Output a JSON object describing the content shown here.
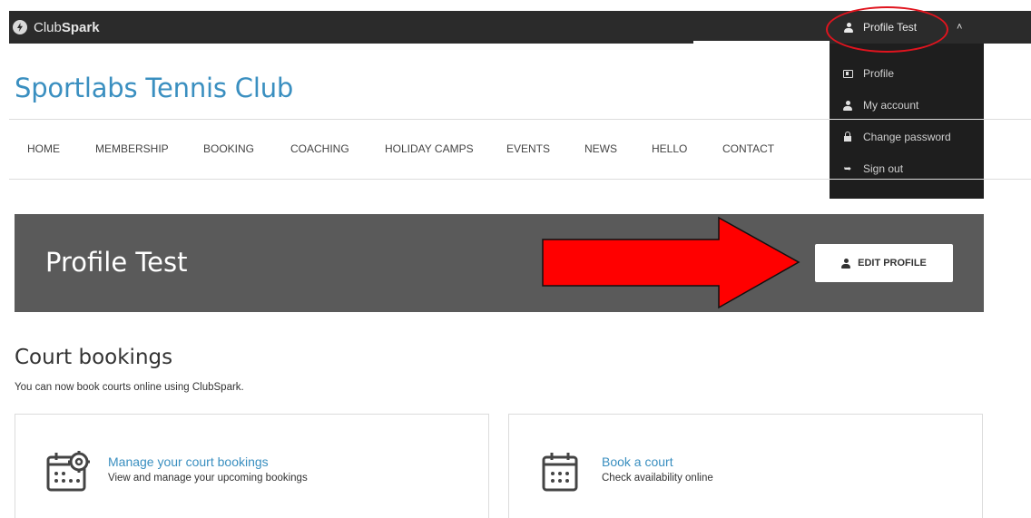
{
  "topbar": {
    "brand_light": "Club",
    "brand_bold": "Spark",
    "user_name": "Profile Test",
    "chevron": "^"
  },
  "dropdown": {
    "items": [
      {
        "label": "Profile",
        "icon": "id-card-icon"
      },
      {
        "label": "My account",
        "icon": "user-icon"
      },
      {
        "label": "Change password",
        "icon": "lock-icon"
      },
      {
        "label": "Sign out",
        "icon": "sign-out-icon"
      }
    ]
  },
  "header": {
    "club_name": "Sportlabs Tennis Club"
  },
  "nav": {
    "items": [
      "HOME",
      "MEMBERSHIP",
      "BOOKING",
      "COACHING",
      "HOLIDAY CAMPS",
      "EVENTS",
      "NEWS",
      "HELLO",
      "CONTACT"
    ]
  },
  "banner": {
    "title": "Profile Test",
    "edit_button": "EDIT PROFILE"
  },
  "court_bookings": {
    "title": "Court bookings",
    "subtitle": "You can now book courts online using ClubSpark.",
    "cards": [
      {
        "title": "Manage your court bookings",
        "description": "View and manage your upcoming bookings",
        "icon": "calendar-gear-icon"
      },
      {
        "title": "Book a court",
        "description": "Check availability online",
        "icon": "calendar-icon"
      }
    ]
  },
  "colors": {
    "accent": "#3a8fc0",
    "topbar": "#2b2b2b",
    "dropdown": "#1e1e1e",
    "banner": "#5a5a5a",
    "annotation_red": "#e0141e"
  }
}
